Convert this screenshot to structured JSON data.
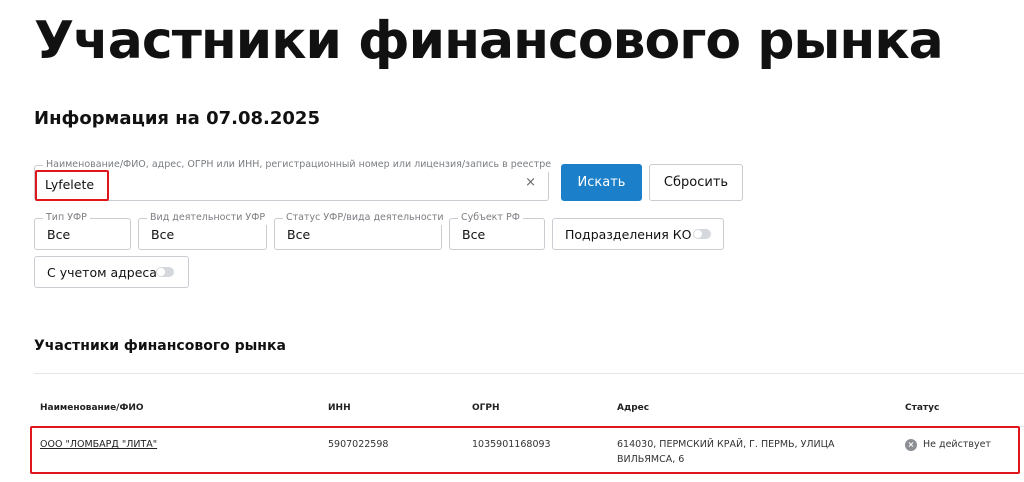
{
  "header": {
    "title": "Участники финансового рынка",
    "info_date": "Информация на 07.08.2025"
  },
  "search": {
    "legend": "Наименование/ФИО, адрес, ОГРН или ИНН, регистрационный номер или лицензия/запись в реестре",
    "value": "Lyfelete",
    "clear_icon": "×",
    "search_button": "Искать",
    "reset_button": "Сбросить"
  },
  "filters": {
    "ufr_type": {
      "legend": "Тип УФР",
      "value": "Все"
    },
    "activity_type": {
      "legend": "Вид деятельности УФР",
      "value": "Все"
    },
    "status": {
      "legend": "Статус УФР/вида деятельности",
      "value": "Все"
    },
    "region": {
      "legend": "Субъект РФ",
      "value": "Все"
    },
    "ko_divisions": {
      "label": "Подразделения КО",
      "enabled": false
    },
    "with_address": {
      "label": "С учетом адреса",
      "enabled": false
    }
  },
  "results": {
    "section_title": "Участники финансового рынка",
    "columns": [
      "Наименование/ФИО",
      "ИНН",
      "ОГРН",
      "Адрес",
      "Статус"
    ],
    "rows": [
      {
        "name": "ООО \"ЛОМБАРД \"ЛИТА\"",
        "inn": "5907022598",
        "ogrn": "1035901168093",
        "address_line1": "614030, ПЕРМСКИЙ КРАЙ, Г. ПЕРМЬ, УЛИЦА",
        "address_line2": "ВИЛЬЯМСА, 6",
        "status": "Не действует",
        "status_icon": "×"
      }
    ]
  },
  "colors": {
    "accent": "#1b7fca",
    "highlight": "#e0161b",
    "status_inactive": "#8b8f94"
  }
}
